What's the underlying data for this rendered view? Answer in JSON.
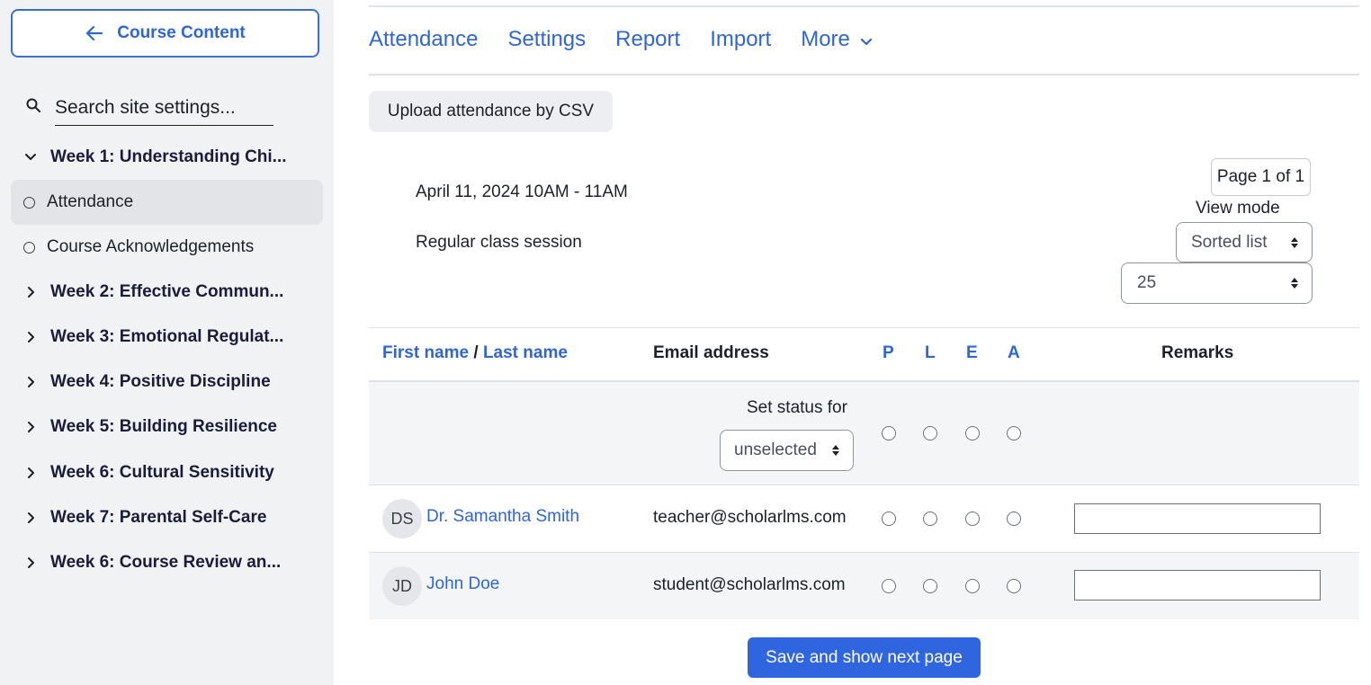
{
  "sidebar": {
    "course_content_label": "Course Content",
    "search_placeholder": "Search site settings...",
    "items": [
      {
        "label": "Week 1: Understanding Chi...",
        "type": "section",
        "expanded": true
      },
      {
        "label": "Attendance",
        "type": "activity",
        "active": true
      },
      {
        "label": "Course Acknowledgements",
        "type": "activity"
      },
      {
        "label": "Week 2: Effective Commun...",
        "type": "section"
      },
      {
        "label": "Week 3: Emotional Regulat...",
        "type": "section"
      },
      {
        "label": "Week 4: Positive Discipline",
        "type": "section"
      },
      {
        "label": "Week 5: Building Resilience",
        "type": "section"
      },
      {
        "label": "Week 6: Cultural Sensitivity",
        "type": "section"
      },
      {
        "label": "Week 7: Parental Self-Care",
        "type": "section"
      },
      {
        "label": "Week 6: Course Review an...",
        "type": "section"
      }
    ]
  },
  "tabs": [
    {
      "label": "Attendance"
    },
    {
      "label": "Settings"
    },
    {
      "label": "Report"
    },
    {
      "label": "Import"
    },
    {
      "label": "More"
    }
  ],
  "upload_button": "Upload attendance by CSV",
  "session": {
    "date": "April 11, 2024 10AM - 11AM",
    "description": "Regular class session"
  },
  "pager": "Page 1 of 1",
  "view_mode": {
    "label": "View mode",
    "selected": "Sorted list"
  },
  "page_size": {
    "selected": "25"
  },
  "table": {
    "headers": {
      "first_name": "First name",
      "separator": "/",
      "last_name": "Last name",
      "email": "Email address",
      "p": "P",
      "l": "L",
      "e": "E",
      "a": "A",
      "remarks": "Remarks"
    },
    "set_status_label": "Set status for",
    "set_status_selected": "unselected",
    "rows": [
      {
        "initials": "DS",
        "name": "Dr. Samantha Smith",
        "email": "teacher@scholarlms.com",
        "remark": ""
      },
      {
        "initials": "JD",
        "name": "John Doe",
        "email": "student@scholarlms.com",
        "remark": ""
      }
    ]
  },
  "save_button": "Save and show next page",
  "colors": {
    "accent": "#2f66d0",
    "primary_button": "#2f66e0",
    "sidebar_bg": "#f1f2f4"
  }
}
